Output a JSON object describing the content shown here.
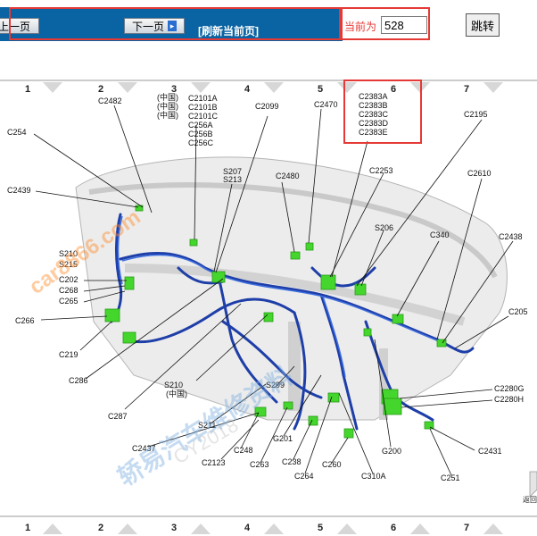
{
  "toolbar": {
    "prev_label": "上一页",
    "next_label": "下一页",
    "refresh_label": "[刷新当前页]",
    "current_label": "当前为",
    "page_value": "528",
    "jump_label": "跳转"
  },
  "grid": {
    "columns": [
      "1",
      "2",
      "3",
      "4",
      "5",
      "6",
      "7"
    ]
  },
  "diagram": {
    "labels": {
      "C2482": "C2482",
      "China1": "(中国)",
      "China2": "(中国)",
      "China3": "(中国)",
      "C2101A": "C2101A",
      "C2101B": "C2101B",
      "C2101C": "C2101C",
      "C256A": "C256A",
      "C256B": "C256B",
      "C256C": "C256C",
      "C2099": "C2099",
      "C2470": "C2470",
      "C2383A": "C2383A",
      "C2383B": "C2383B",
      "C2383C": "C2383C",
      "C2383D": "C2383D",
      "C2383E": "C2383E",
      "C2195": "C2195",
      "C254": "C254",
      "S207": "S207",
      "S213": "S213",
      "C2480": "C2480",
      "C2253": "C2253",
      "C2610": "C2610",
      "C2439": "C2439",
      "S206": "S206",
      "C340": "C340",
      "C2438": "C2438",
      "S210a": "S210",
      "S215": "S215",
      "C202": "C202",
      "C268": "C268",
      "C265": "C265",
      "C205": "C205",
      "C266": "C266",
      "C219": "C219",
      "C286": "C286",
      "S210b": "S210",
      "China4": "(中国)",
      "S299": "S299",
      "C2280G": "C2280G",
      "C2280H": "C2280H",
      "C287": "C287",
      "S211": "S211",
      "G201": "G201",
      "G200": "G200",
      "C2431": "C2431",
      "C2437": "C2437",
      "C248": "C248",
      "C2123": "C2123",
      "C263": "C263",
      "C238": "C238",
      "C264": "C264",
      "C260": "C260",
      "C310A": "C310A",
      "C251": "C251",
      "back": "返回"
    }
  },
  "watermarks": {
    "site": "car8866.com",
    "brand": "轿易汽车维修资料",
    "code": "CY2018"
  },
  "colors": {
    "toolbar_blue": "#0a63a2",
    "highlight_red": "#e53935",
    "harness_blue": "#1e3ea8",
    "connector_green": "#44d62c"
  }
}
